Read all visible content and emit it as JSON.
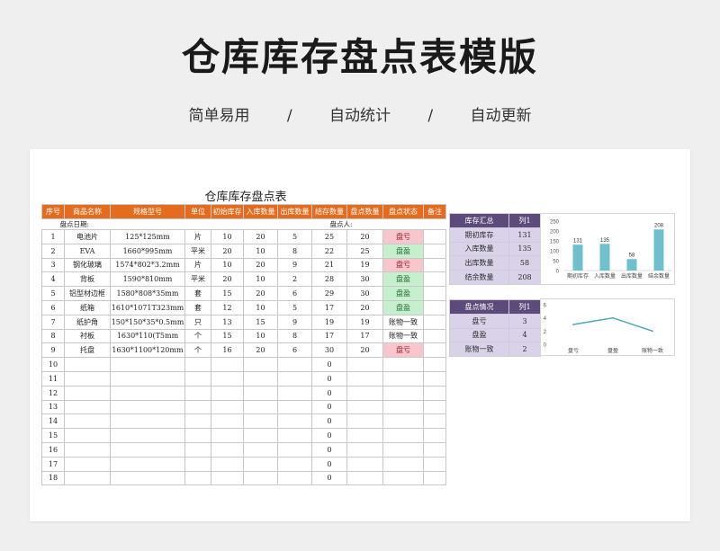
{
  "hero": {
    "title": "仓库库存盘点表模版",
    "tags": [
      "简单易用",
      "/",
      "自动统计",
      "/",
      "自动更新"
    ]
  },
  "sheet": {
    "title": "仓库库存盘点表",
    "meta_date_label": "盘点日期:",
    "meta_person_label": "盘点人:",
    "headers": [
      "序号",
      "商品名称",
      "规格型号",
      "单位",
      "初始库存",
      "入库数量",
      "出库数量",
      "结存数量",
      "盘点数量",
      "盘点状态",
      "备注"
    ],
    "rows": [
      [
        "1",
        "电池片",
        "125*125mm",
        "片",
        "10",
        "20",
        "5",
        "25",
        "20",
        "盘亏",
        ""
      ],
      [
        "2",
        "EVA",
        "1660*995mm",
        "平米",
        "20",
        "10",
        "8",
        "22",
        "25",
        "盘盈",
        ""
      ],
      [
        "3",
        "钢化玻璃",
        "1574*802*3.2mm",
        "片",
        "10",
        "20",
        "9",
        "21",
        "19",
        "盘亏",
        ""
      ],
      [
        "4",
        "背板",
        "1590*810mm",
        "平米",
        "20",
        "10",
        "2",
        "28",
        "30",
        "盘盈",
        ""
      ],
      [
        "5",
        "铝型材边框",
        "1580*808*35mm",
        "套",
        "15",
        "20",
        "6",
        "29",
        "30",
        "盘盈",
        ""
      ],
      [
        "6",
        "纸箱",
        "1610*1071T323mm",
        "套",
        "12",
        "10",
        "5",
        "17",
        "20",
        "盘盈",
        ""
      ],
      [
        "7",
        "纸护角",
        "150*150*35*0.5mm",
        "只",
        "13",
        "15",
        "9",
        "19",
        "19",
        "账物一致",
        ""
      ],
      [
        "8",
        "衬板",
        "1630*110(T5mm",
        "个",
        "15",
        "10",
        "8",
        "17",
        "17",
        "账物一致",
        ""
      ],
      [
        "9",
        "托盘",
        "1630*1100*120mm",
        "个",
        "16",
        "20",
        "6",
        "30",
        "20",
        "盘亏",
        ""
      ],
      [
        "10",
        "",
        "",
        "",
        "",
        "",
        "",
        "0",
        "",
        "",
        ""
      ],
      [
        "11",
        "",
        "",
        "",
        "",
        "",
        "",
        "0",
        "",
        "",
        ""
      ],
      [
        "12",
        "",
        "",
        "",
        "",
        "",
        "",
        "0",
        "",
        "",
        ""
      ],
      [
        "13",
        "",
        "",
        "",
        "",
        "",
        "",
        "0",
        "",
        "",
        ""
      ],
      [
        "14",
        "",
        "",
        "",
        "",
        "",
        "",
        "0",
        "",
        "",
        ""
      ],
      [
        "15",
        "",
        "",
        "",
        "",
        "",
        "",
        "0",
        "",
        "",
        ""
      ],
      [
        "16",
        "",
        "",
        "",
        "",
        "",
        "",
        "0",
        "",
        "",
        ""
      ],
      [
        "17",
        "",
        "",
        "",
        "",
        "",
        "",
        "0",
        "",
        "",
        ""
      ],
      [
        "18",
        "",
        "",
        "",
        "",
        "",
        "",
        "0",
        "",
        "",
        ""
      ]
    ],
    "status_colors": {
      "盘亏": "#f8c6cc",
      "盘盈": "#c6efce"
    }
  },
  "summary_stock": {
    "headers": [
      "库存汇总",
      "列1"
    ],
    "rows": [
      [
        "期初库存",
        "131"
      ],
      [
        "入库数量",
        "135"
      ],
      [
        "出库数量",
        "58"
      ],
      [
        "结余数量",
        "208"
      ]
    ]
  },
  "summary_check": {
    "headers": [
      "盘点情况",
      "列1"
    ],
    "rows": [
      [
        "盘亏",
        "3"
      ],
      [
        "盘盈",
        "4"
      ],
      [
        "账物一致",
        "2"
      ]
    ]
  },
  "chart_data": [
    {
      "type": "bar",
      "categories": [
        "期初库存",
        "入库数量",
        "出库数量",
        "结余数量"
      ],
      "values": [
        131,
        135,
        58,
        208
      ],
      "ylim": [
        0,
        250
      ],
      "yticks": [
        0,
        50,
        100,
        150,
        200,
        250
      ],
      "color": "#6fbfcc",
      "data_labels": true
    },
    {
      "type": "line",
      "categories": [
        "盘亏",
        "盘盈",
        "账物一致"
      ],
      "values": [
        3,
        4,
        2
      ],
      "ylim": [
        0,
        6
      ],
      "yticks": [
        0,
        2,
        4,
        6
      ],
      "color": "#4aa6b8"
    }
  ]
}
